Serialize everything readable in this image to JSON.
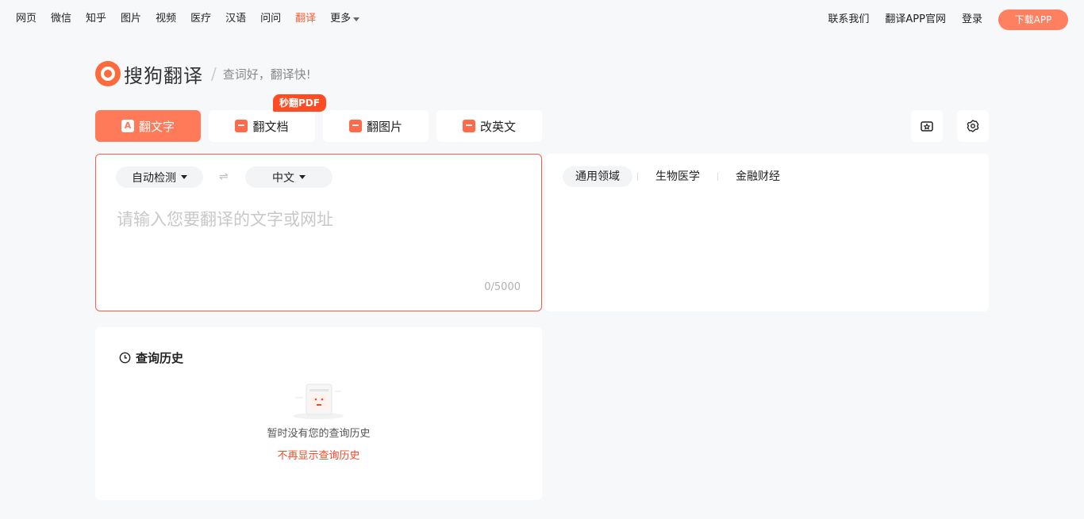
{
  "topnav": {
    "left_links": [
      "网页",
      "微信",
      "知乎",
      "图片",
      "视频",
      "医疗",
      "汉语",
      "问问",
      "翻译",
      "更多"
    ],
    "active_link": "翻译",
    "right_links": [
      "联系我们",
      "翻译APP官网",
      "登录"
    ],
    "download_label": "下载APP"
  },
  "brand": {
    "logo_text": "搜狗翻译",
    "separator": "/",
    "slogan": "查词好，翻译快!"
  },
  "tabs": {
    "text": "翻文字",
    "doc": "翻文档",
    "image": "翻图片",
    "edit": "改英文",
    "pdf_badge": "秒翻PDF",
    "text_icon_glyph": "A"
  },
  "input": {
    "source_lang": "自动检测",
    "target_lang": "中文",
    "swap_glyph": "⇌",
    "placeholder": "请输入您要翻译的文字或网址",
    "counter": "0/5000"
  },
  "output": {
    "domains": [
      "通用领域",
      "生物医学",
      "金融财经"
    ],
    "active_domain": "通用领域"
  },
  "history": {
    "title": "查询历史",
    "empty_text": "暂时没有您的查询历史",
    "hide_link": "不再显示查询历史"
  },
  "colors": {
    "accent": "#ff7a58",
    "active_nav": "#fd5d32",
    "badge": "#fe4d24",
    "link": "#f04a2a"
  },
  "icons": [
    "camera-star-icon",
    "settings-icon",
    "clock-icon",
    "empty-history-illustration"
  ]
}
